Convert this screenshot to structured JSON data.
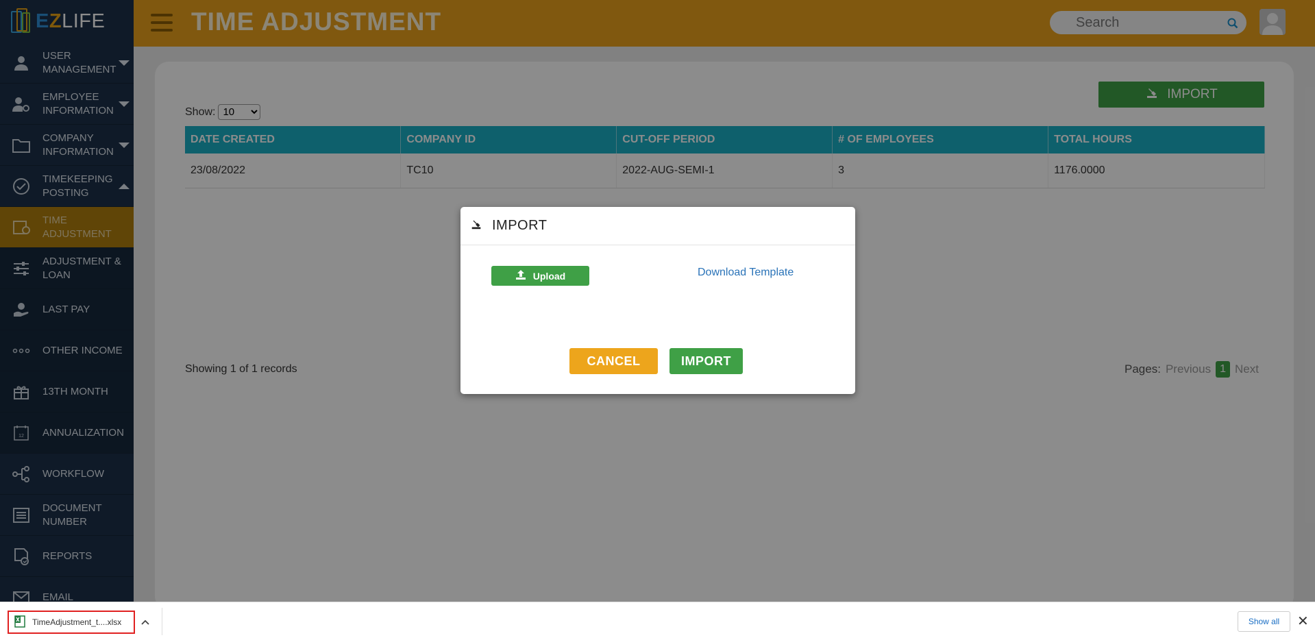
{
  "app": {
    "brand_e": "E",
    "brand_z": "Z",
    "brand_life": "LIFE"
  },
  "header": {
    "title": "TIME ADJUSTMENT",
    "search_placeholder": "Search"
  },
  "sidebar": {
    "items": [
      {
        "label": "USER MANAGEMENT",
        "icon": "user-icon",
        "caret": "down"
      },
      {
        "label": "EMPLOYEE INFORMATION",
        "icon": "user-gear-icon",
        "caret": "down"
      },
      {
        "label": "COMPANY INFORMATION",
        "icon": "folder-icon",
        "caret": "down"
      },
      {
        "label": "TIMEKEEPING POSTING",
        "icon": "check-circle-icon",
        "caret": "up"
      },
      {
        "label": "TIME ADJUSTMENT",
        "icon": "calendar-clock-icon",
        "sub": true,
        "active": true
      },
      {
        "label": "ADJUSTMENT & LOAN",
        "icon": "sliders-icon",
        "sub": true
      },
      {
        "label": "LAST PAY",
        "icon": "hand-money-icon",
        "sub": true
      },
      {
        "label": "OTHER INCOME",
        "icon": "dots-icon",
        "sub": true
      },
      {
        "label": "13TH MONTH",
        "icon": "gift-icon",
        "sub": true
      },
      {
        "label": "ANNUALIZATION",
        "icon": "calendar-12-icon",
        "sub": true
      },
      {
        "label": "WORKFLOW",
        "icon": "workflow-icon"
      },
      {
        "label": "DOCUMENT NUMBER",
        "icon": "list-doc-icon"
      },
      {
        "label": "REPORTS",
        "icon": "report-icon"
      },
      {
        "label": "EMAIL",
        "icon": "mail-icon"
      }
    ]
  },
  "main": {
    "import_button": "IMPORT",
    "show_label": "Show:",
    "show_value": "10",
    "table": {
      "columns": [
        "DATE CREATED",
        "COMPANY ID",
        "CUT-OFF PERIOD",
        "# OF EMPLOYEES",
        "TOTAL HOURS"
      ],
      "rows": [
        [
          "23/08/2022",
          "TC10",
          "2022-AUG-SEMI-1",
          "3",
          "1176.0000"
        ]
      ]
    },
    "records_text": "Showing 1 of 1 records",
    "pagination": {
      "label": "Pages:",
      "previous": "Previous",
      "current": "1",
      "next": "Next"
    }
  },
  "modal": {
    "title": "IMPORT",
    "upload_label": "Upload",
    "download_template": "Download Template",
    "cancel": "CANCEL",
    "import": "IMPORT"
  },
  "download_bar": {
    "file_name": "TimeAdjustment_t....xlsx",
    "show_all": "Show all"
  },
  "colors": {
    "header": "#e9a11c",
    "sidebar": "#1c3149",
    "table_header": "#1ab0c5",
    "primary_green": "#3fa046",
    "cancel_orange": "#eda51c"
  }
}
